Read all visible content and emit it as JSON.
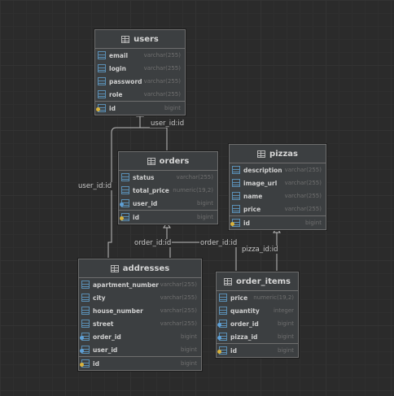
{
  "tables": {
    "users": {
      "title": "users",
      "columns": [
        {
          "name": "email",
          "type": "varchar(255)",
          "icon": "column-icon"
        },
        {
          "name": "login",
          "type": "varchar(255)",
          "icon": "column-icon"
        },
        {
          "name": "password",
          "type": "varchar(255)",
          "icon": "column-icon"
        },
        {
          "name": "role",
          "type": "varchar(255)",
          "icon": "column-icon"
        },
        {
          "name": "id",
          "type": "bigint",
          "icon": "primary-key-icon"
        }
      ]
    },
    "orders": {
      "title": "orders",
      "columns": [
        {
          "name": "status",
          "type": "varchar(255)",
          "icon": "column-icon"
        },
        {
          "name": "total_price",
          "type": "numeric(19,2)",
          "icon": "column-icon"
        },
        {
          "name": "user_id",
          "type": "bigint",
          "icon": "foreign-key-icon"
        },
        {
          "name": "id",
          "type": "bigint",
          "icon": "primary-key-icon"
        }
      ]
    },
    "pizzas": {
      "title": "pizzas",
      "columns": [
        {
          "name": "description",
          "type": "varchar(255)",
          "icon": "column-icon"
        },
        {
          "name": "image_url",
          "type": "varchar(255)",
          "icon": "column-icon"
        },
        {
          "name": "name",
          "type": "varchar(255)",
          "icon": "column-icon"
        },
        {
          "name": "price",
          "type": "varchar(255)",
          "icon": "column-icon"
        },
        {
          "name": "id",
          "type": "bigint",
          "icon": "primary-key-icon"
        }
      ]
    },
    "addresses": {
      "title": "addresses",
      "columns": [
        {
          "name": "apartment_number",
          "type": "varchar(255)",
          "icon": "column-icon"
        },
        {
          "name": "city",
          "type": "varchar(255)",
          "icon": "column-icon"
        },
        {
          "name": "house_number",
          "type": "varchar(255)",
          "icon": "column-icon"
        },
        {
          "name": "street",
          "type": "varchar(255)",
          "icon": "column-icon"
        },
        {
          "name": "order_id",
          "type": "bigint",
          "icon": "foreign-key-icon"
        },
        {
          "name": "user_id",
          "type": "bigint",
          "icon": "foreign-key-icon"
        },
        {
          "name": "id",
          "type": "bigint",
          "icon": "primary-key-icon"
        }
      ]
    },
    "order_items": {
      "title": "order_items",
      "columns": [
        {
          "name": "price",
          "type": "numeric(19,2)",
          "icon": "column-icon"
        },
        {
          "name": "quantity",
          "type": "integer",
          "icon": "column-icon"
        },
        {
          "name": "order_id",
          "type": "bigint",
          "icon": "foreign-key-icon"
        },
        {
          "name": "pizza_id",
          "type": "bigint",
          "icon": "foreign-key-icon"
        },
        {
          "name": "id",
          "type": "bigint",
          "icon": "primary-key-icon"
        }
      ]
    }
  },
  "relations": [
    {
      "label": "user_id:id",
      "from": "orders",
      "to": "users"
    },
    {
      "label": "user_id:id",
      "from": "addresses",
      "to": "users"
    },
    {
      "label": "order_id:id",
      "from": "addresses",
      "to": "orders"
    },
    {
      "label": "order_id:id",
      "from": "order_items",
      "to": "orders"
    },
    {
      "label": "pizza_id:id",
      "from": "order_items",
      "to": "pizzas"
    }
  ]
}
